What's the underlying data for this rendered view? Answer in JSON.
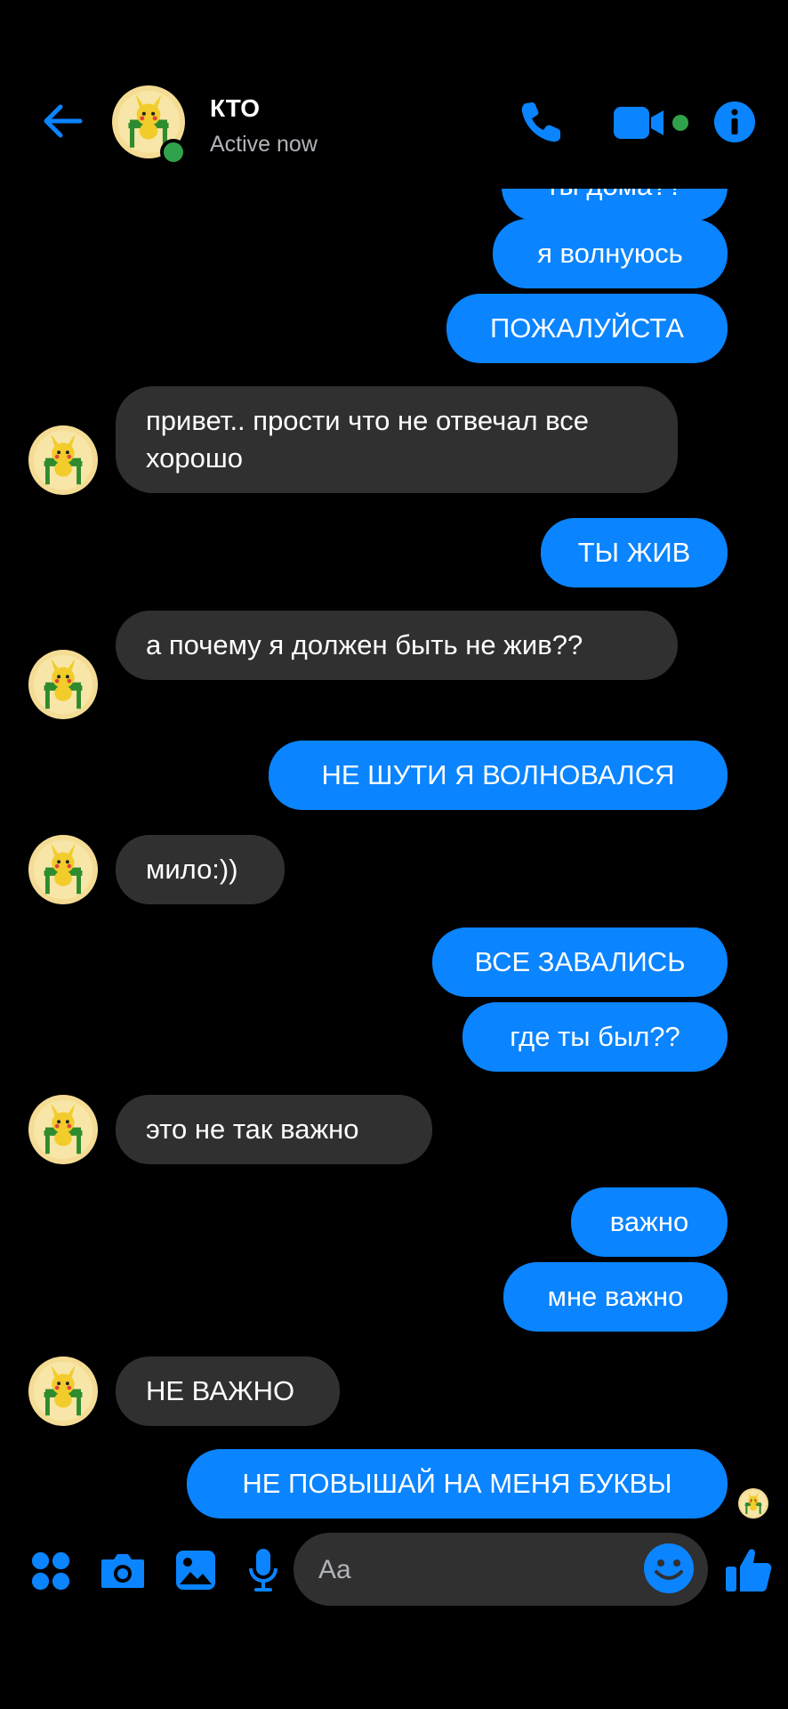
{
  "header": {
    "contact_name": "КТО",
    "status": "Active now"
  },
  "messages": [
    {
      "from": "me",
      "text": "ты дома??"
    },
    {
      "from": "me",
      "text": "я волнуюсь"
    },
    {
      "from": "me",
      "text": "ПОЖАЛУЙСТА"
    },
    {
      "from": "them",
      "text": "привет.. прости что не отвечал все хорошо"
    },
    {
      "from": "me",
      "text": "ТЫ ЖИВ"
    },
    {
      "from": "them",
      "text": "а почему я должен быть не жив??"
    },
    {
      "from": "me",
      "text": "НЕ ШУТИ Я ВОЛНОВАЛСЯ"
    },
    {
      "from": "them",
      "text": "мило:))"
    },
    {
      "from": "me",
      "text": "ВСЕ ЗАВАЛИСЬ"
    },
    {
      "from": "me",
      "text": "где ты был??"
    },
    {
      "from": "them",
      "text": "это не так важно"
    },
    {
      "from": "me",
      "text": "важно"
    },
    {
      "from": "me",
      "text": "мне важно"
    },
    {
      "from": "them",
      "text": "НЕ ВАЖНО"
    },
    {
      "from": "me",
      "text": "НЕ ПОВЫШАЙ НА МЕНЯ БУКВЫ"
    }
  ],
  "composer": {
    "placeholder": "Aa"
  },
  "colors": {
    "accent": "#0a84ff",
    "incoming_bubble": "#303030",
    "online": "#31a24c",
    "background": "#000000"
  },
  "icons": {
    "back": "arrow-left-icon",
    "call": "phone-icon",
    "video": "video-camera-icon",
    "info": "info-icon",
    "apps": "four-dots-icon",
    "camera": "camera-icon",
    "gallery": "image-icon",
    "mic": "microphone-icon",
    "emoji": "smiley-icon",
    "like": "thumbs-up-icon"
  }
}
